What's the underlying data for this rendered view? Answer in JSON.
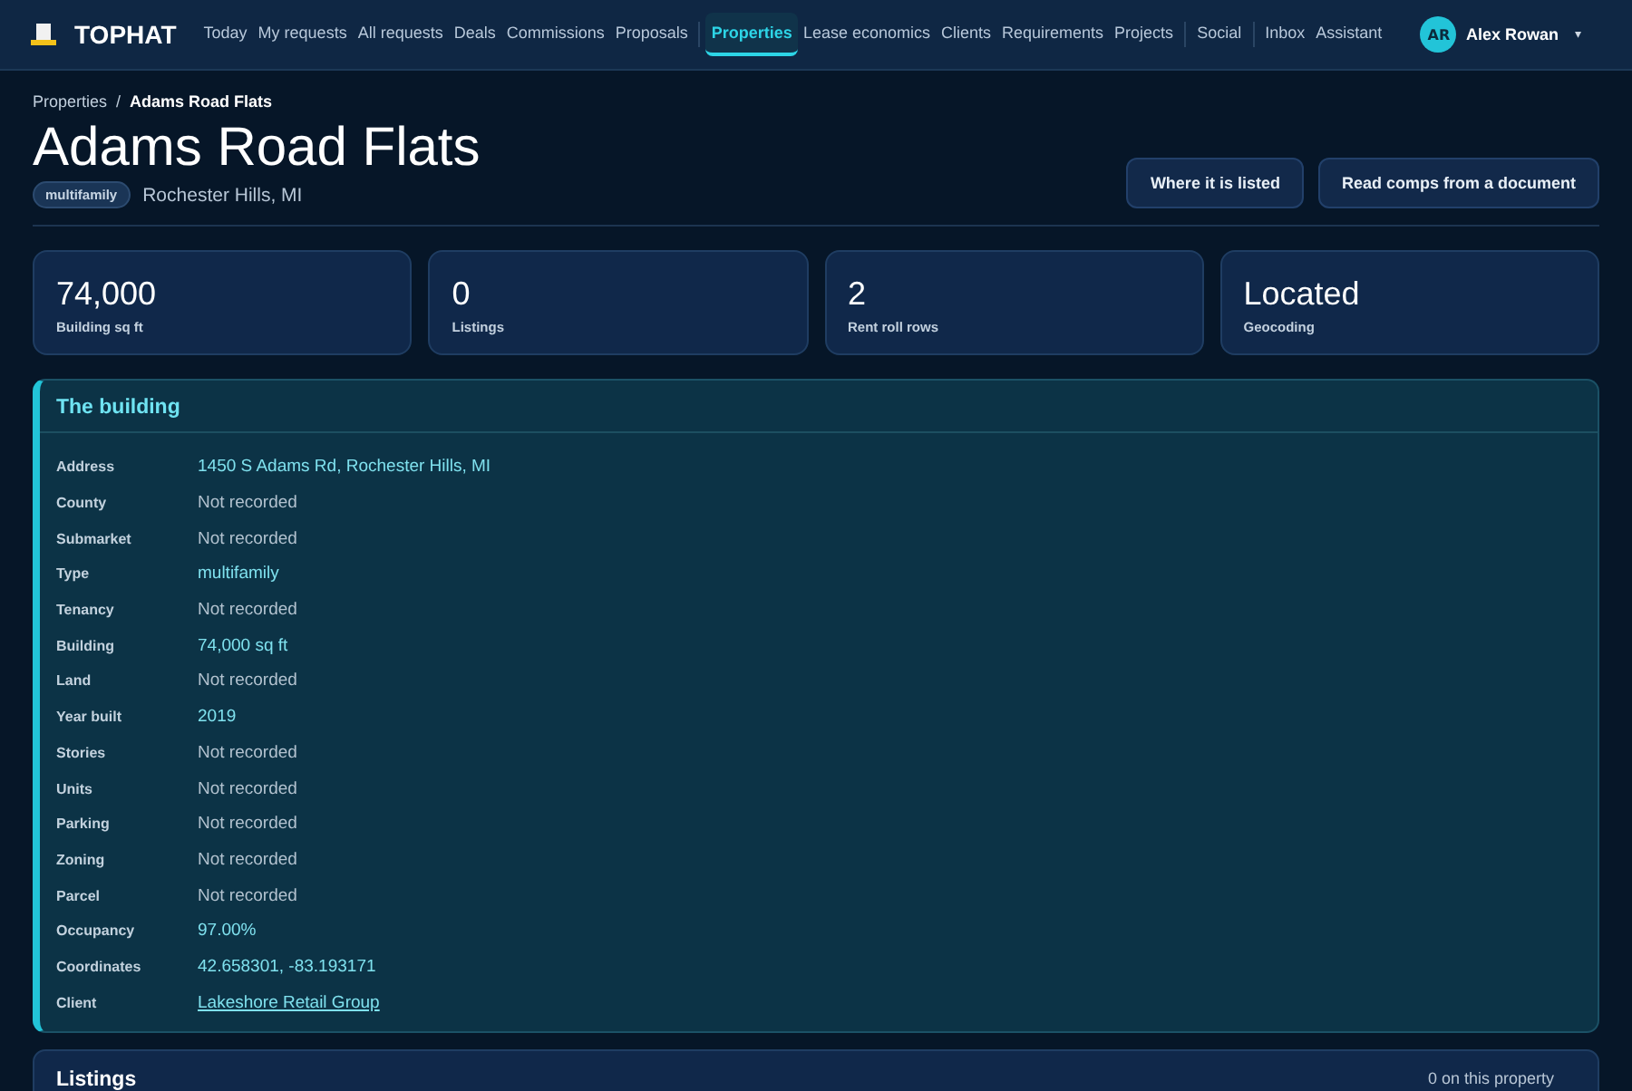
{
  "app": {
    "name": "TOPHAT"
  },
  "nav": [
    {
      "label": "Today",
      "selected": false,
      "separator_after": false
    },
    {
      "label": "My requests",
      "selected": false,
      "separator_after": false
    },
    {
      "label": "All requests",
      "selected": false,
      "separator_after": false
    },
    {
      "label": "Deals",
      "selected": false,
      "separator_after": false
    },
    {
      "label": "Commissions",
      "selected": false,
      "separator_after": false
    },
    {
      "label": "Proposals",
      "selected": false,
      "separator_after": true
    },
    {
      "label": "Properties",
      "selected": true,
      "separator_after": false
    },
    {
      "label": "Lease economics",
      "selected": false,
      "separator_after": false
    },
    {
      "label": "Clients",
      "selected": false,
      "separator_after": false
    },
    {
      "label": "Requirements",
      "selected": false,
      "separator_after": false
    },
    {
      "label": "Projects",
      "selected": false,
      "separator_after": true
    },
    {
      "label": "Social",
      "selected": false,
      "separator_after": true
    },
    {
      "label": "Inbox",
      "selected": false,
      "separator_after": false
    },
    {
      "label": "Assistant",
      "selected": false,
      "separator_after": false
    }
  ],
  "user": {
    "initials": "AR",
    "name": "Alex Rowan",
    "caret": "▾"
  },
  "breadcrumb": [
    {
      "label": "Properties"
    },
    {
      "label": "Adams Road Flats"
    }
  ],
  "breadcrumb_separator": "/",
  "title": "Adams Road Flats",
  "tag": "multifamily",
  "location": "Rochester Hills, MI",
  "actions": [
    "Where it is listed",
    "Read comps from a document"
  ],
  "stats": [
    {
      "value": "74,000",
      "label": "Building sq ft"
    },
    {
      "value": "0",
      "label": "Listings"
    },
    {
      "value": "2",
      "label": "Rent roll rows"
    },
    {
      "value": "Located",
      "label": "Geocoding"
    }
  ],
  "building": {
    "title": "The building",
    "rows": [
      {
        "label": "Address",
        "value": "1450 S Adams Rd, Rochester Hills, MI",
        "kind": "text"
      },
      {
        "label": "County",
        "value": "Not recorded",
        "kind": "missing"
      },
      {
        "label": "Submarket",
        "value": "Not recorded",
        "kind": "missing"
      },
      {
        "label": "Type",
        "value": "multifamily",
        "kind": "text"
      },
      {
        "label": "Tenancy",
        "value": "Not recorded",
        "kind": "missing"
      },
      {
        "label": "Building",
        "value": "74,000 sq ft",
        "kind": "text"
      },
      {
        "label": "Land",
        "value": "Not recorded",
        "kind": "missing"
      },
      {
        "label": "Year built",
        "value": "2019",
        "kind": "text"
      },
      {
        "label": "Stories",
        "value": "Not recorded",
        "kind": "missing"
      },
      {
        "label": "Units",
        "value": "Not recorded",
        "kind": "missing"
      },
      {
        "label": "Parking",
        "value": "Not recorded",
        "kind": "missing"
      },
      {
        "label": "Zoning",
        "value": "Not recorded",
        "kind": "missing"
      },
      {
        "label": "Parcel",
        "value": "Not recorded",
        "kind": "missing"
      },
      {
        "label": "Occupancy",
        "value": "97.00%",
        "kind": "text"
      },
      {
        "label": "Coordinates",
        "value": "42.658301, -83.193171",
        "kind": "text"
      },
      {
        "label": "Client",
        "value": "Lakeshore Retail Group",
        "kind": "link"
      }
    ]
  },
  "listings": {
    "title": "Listings",
    "count": "0 on this property"
  }
}
